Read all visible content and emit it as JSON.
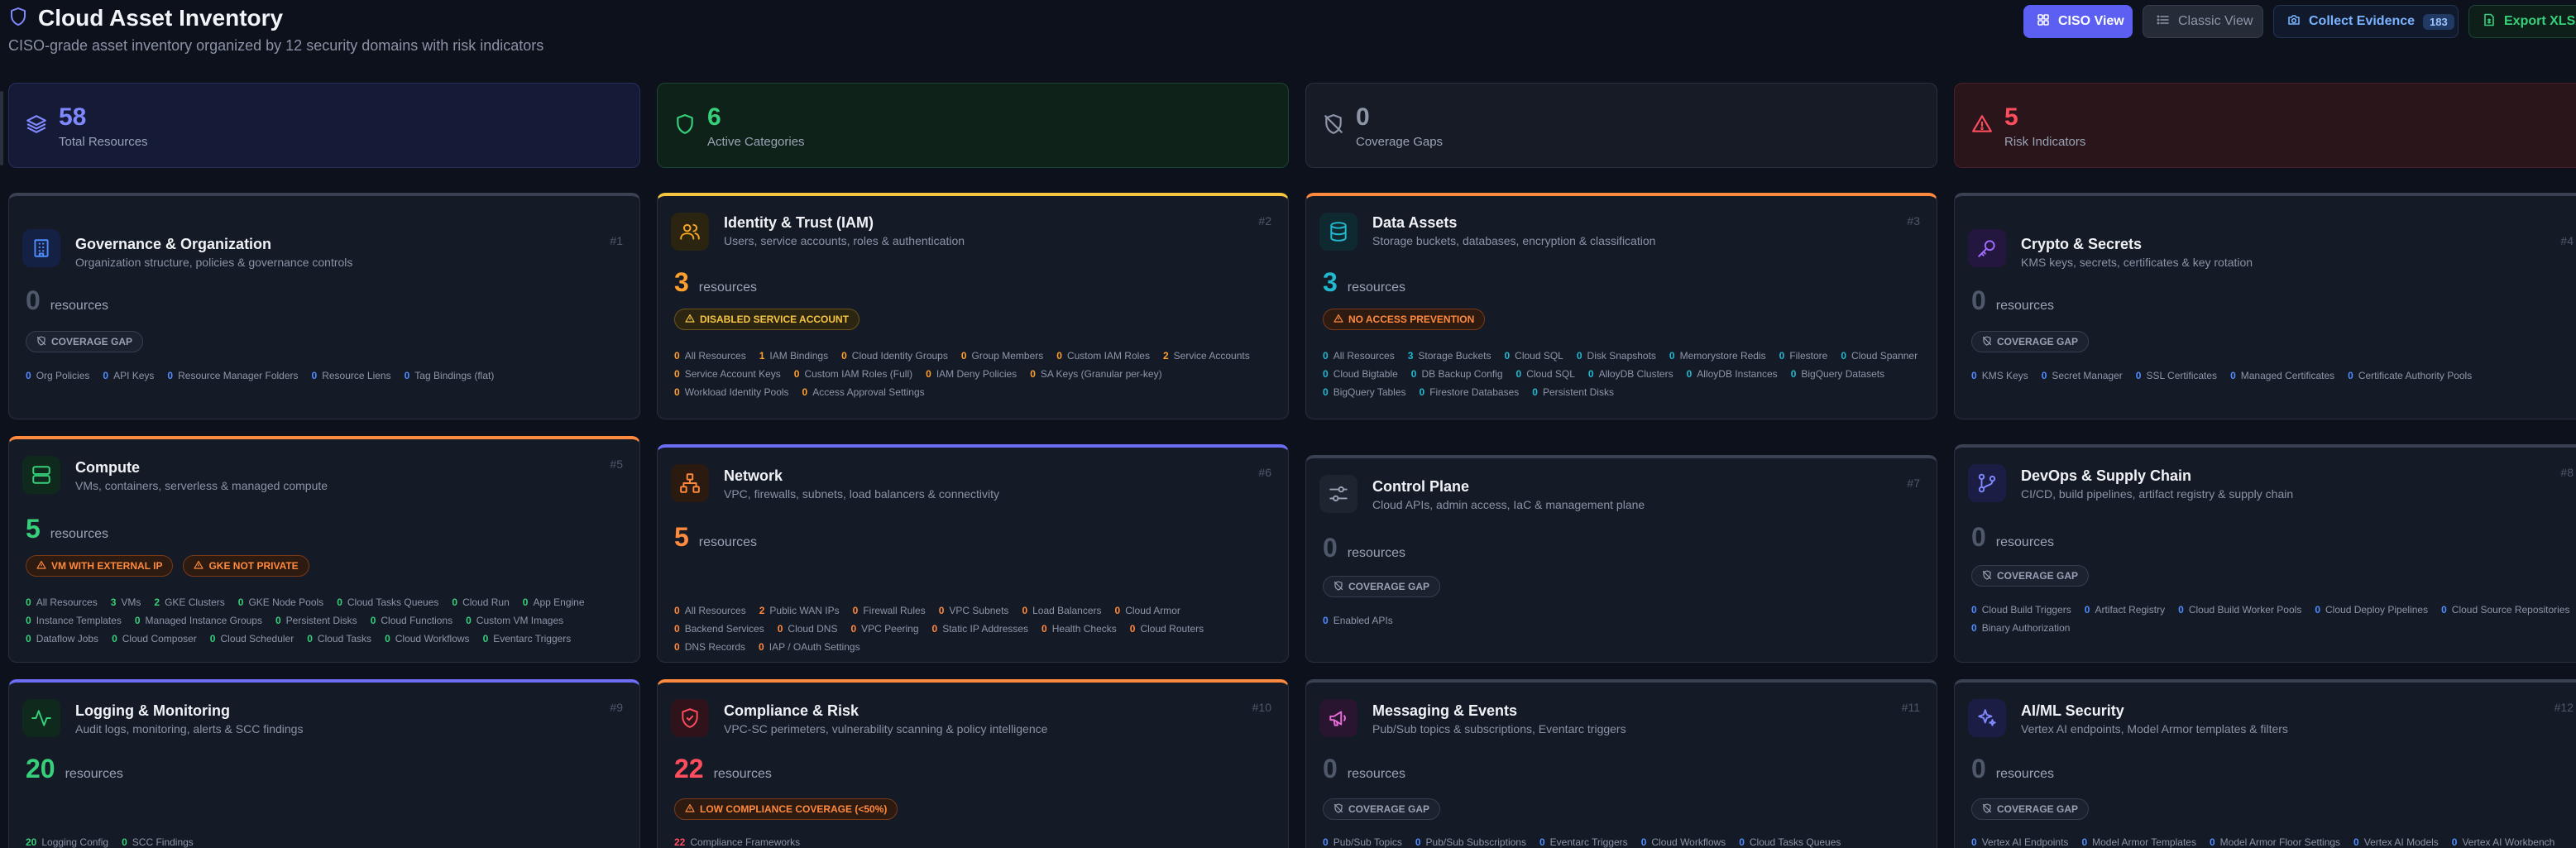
{
  "header": {
    "title": "Cloud Asset Inventory",
    "subtitle": "CISO-grade asset inventory organized by 12 security domains with risk indicators"
  },
  "actions": {
    "ciso_view": "CISO View",
    "classic_view": "Classic View",
    "collect_evidence": "Collect Evidence",
    "evidence_count": "183",
    "export_xlsx": "Export XLSX"
  },
  "stats": {
    "total": {
      "value": "58",
      "label": "Total Resources"
    },
    "active": {
      "value": "6",
      "label": "Active Categories"
    },
    "gaps": {
      "value": "0",
      "label": "Coverage Gaps"
    },
    "risk": {
      "value": "5",
      "label": "Risk Indicators"
    }
  },
  "resources_label": "resources",
  "colors": {
    "accent": "#5b5ff2",
    "green": "#36d07a",
    "orange": "#ff8a3d",
    "yellow": "#f5c542",
    "cyan": "#22b8cf",
    "red": "#ff4d5e",
    "gray": "#4f586a"
  },
  "cards": [
    {
      "title": "Governance & Organization",
      "desc": "Organization structure, policies & governance controls",
      "num": "#1",
      "count": "0",
      "icon": "building-icon",
      "badges": [
        {
          "label": "COVERAGE GAP",
          "type": "gap"
        }
      ],
      "items": [
        {
          "c": "0",
          "l": "Org Policies"
        },
        {
          "c": "0",
          "l": "API Keys"
        },
        {
          "c": "0",
          "l": "Resource Manager Folders"
        },
        {
          "c": "0",
          "l": "Resource Liens"
        },
        {
          "c": "0",
          "l": "Tag Bindings (flat)"
        }
      ]
    },
    {
      "title": "Identity & Trust (IAM)",
      "desc": "Users, service accounts, roles & authentication",
      "num": "#2",
      "count": "3",
      "icon": "users-icon",
      "badges": [
        {
          "label": "DISABLED SERVICE ACCOUNT",
          "type": "yellow"
        }
      ],
      "items": [
        {
          "c": "0",
          "l": "All Resources"
        },
        {
          "c": "1",
          "l": "IAM Bindings"
        },
        {
          "c": "0",
          "l": "Cloud Identity Groups"
        },
        {
          "c": "0",
          "l": "Group Members"
        },
        {
          "c": "0",
          "l": "Custom IAM Roles"
        },
        {
          "c": "2",
          "l": "Service Accounts"
        },
        {
          "c": "0",
          "l": "Service Account Keys"
        },
        {
          "c": "0",
          "l": "Custom IAM Roles (Full)"
        },
        {
          "c": "0",
          "l": "IAM Deny Policies"
        },
        {
          "c": "0",
          "l": "SA Keys (Granular per-key)"
        },
        {
          "c": "0",
          "l": "Workload Identity Pools"
        },
        {
          "c": "0",
          "l": "Access Approval Settings"
        }
      ]
    },
    {
      "title": "Data Assets",
      "desc": "Storage buckets, databases, encryption & classification",
      "num": "#3",
      "count": "3",
      "icon": "database-icon",
      "badges": [
        {
          "label": "NO ACCESS PREVENTION",
          "type": "orange"
        }
      ],
      "items": [
        {
          "c": "0",
          "l": "All Resources"
        },
        {
          "c": "3",
          "l": "Storage Buckets"
        },
        {
          "c": "0",
          "l": "Cloud SQL"
        },
        {
          "c": "0",
          "l": "Disk Snapshots"
        },
        {
          "c": "0",
          "l": "Memorystore Redis"
        },
        {
          "c": "0",
          "l": "Filestore"
        },
        {
          "c": "0",
          "l": "Cloud Spanner"
        },
        {
          "c": "0",
          "l": "Cloud Bigtable"
        },
        {
          "c": "0",
          "l": "DB Backup Config"
        },
        {
          "c": "0",
          "l": "Cloud SQL"
        },
        {
          "c": "0",
          "l": "AlloyDB Clusters"
        },
        {
          "c": "0",
          "l": "AlloyDB Instances"
        },
        {
          "c": "0",
          "l": "BigQuery Datasets"
        },
        {
          "c": "0",
          "l": "BigQuery Tables"
        },
        {
          "c": "0",
          "l": "Firestore Databases"
        },
        {
          "c": "0",
          "l": "Persistent Disks"
        }
      ]
    },
    {
      "title": "Crypto & Secrets",
      "desc": "KMS keys, secrets, certificates & key rotation",
      "num": "#4",
      "count": "0",
      "icon": "key-icon",
      "badges": [
        {
          "label": "COVERAGE GAP",
          "type": "gap"
        }
      ],
      "items": [
        {
          "c": "0",
          "l": "KMS Keys"
        },
        {
          "c": "0",
          "l": "Secret Manager"
        },
        {
          "c": "0",
          "l": "SSL Certificates"
        },
        {
          "c": "0",
          "l": "Managed Certificates"
        },
        {
          "c": "0",
          "l": "Certificate Authority Pools"
        }
      ]
    },
    {
      "title": "Compute",
      "desc": "VMs, containers, serverless & managed compute",
      "num": "#5",
      "count": "5",
      "icon": "server-icon",
      "badges": [
        {
          "label": "VM WITH EXTERNAL IP",
          "type": "orange"
        },
        {
          "label": "GKE NOT PRIVATE",
          "type": "orange"
        }
      ],
      "items": [
        {
          "c": "0",
          "l": "All Resources"
        },
        {
          "c": "3",
          "l": "VMs"
        },
        {
          "c": "2",
          "l": "GKE Clusters"
        },
        {
          "c": "0",
          "l": "GKE Node Pools"
        },
        {
          "c": "0",
          "l": "Cloud Tasks Queues"
        },
        {
          "c": "0",
          "l": "Cloud Run"
        },
        {
          "c": "0",
          "l": "App Engine"
        },
        {
          "c": "0",
          "l": "Instance Templates"
        },
        {
          "c": "0",
          "l": "Managed Instance Groups"
        },
        {
          "c": "0",
          "l": "Persistent Disks"
        },
        {
          "c": "0",
          "l": "Cloud Functions"
        },
        {
          "c": "0",
          "l": "Custom VM Images"
        },
        {
          "c": "0",
          "l": "Dataflow Jobs"
        },
        {
          "c": "0",
          "l": "Cloud Composer"
        },
        {
          "c": "0",
          "l": "Cloud Scheduler"
        },
        {
          "c": "0",
          "l": "Cloud Tasks"
        },
        {
          "c": "0",
          "l": "Cloud Workflows"
        },
        {
          "c": "0",
          "l": "Eventarc Triggers"
        }
      ]
    },
    {
      "title": "Network",
      "desc": "VPC, firewalls, subnets, load balancers & connectivity",
      "num": "#6",
      "count": "5",
      "icon": "network-icon",
      "badges": [],
      "items": [
        {
          "c": "0",
          "l": "All Resources"
        },
        {
          "c": "2",
          "l": "Public WAN IPs"
        },
        {
          "c": "0",
          "l": "Firewall Rules"
        },
        {
          "c": "0",
          "l": "VPC Subnets"
        },
        {
          "c": "0",
          "l": "Load Balancers"
        },
        {
          "c": "0",
          "l": "Cloud Armor"
        },
        {
          "c": "0",
          "l": "Backend Services"
        },
        {
          "c": "0",
          "l": "Cloud DNS"
        },
        {
          "c": "0",
          "l": "VPC Peering"
        },
        {
          "c": "0",
          "l": "Static IP Addresses"
        },
        {
          "c": "0",
          "l": "Health Checks"
        },
        {
          "c": "0",
          "l": "Cloud Routers"
        },
        {
          "c": "0",
          "l": "DNS Records"
        },
        {
          "c": "0",
          "l": "IAP / OAuth Settings"
        }
      ]
    },
    {
      "title": "Control Plane",
      "desc": "Cloud APIs, admin access, IaC & management plane",
      "num": "#7",
      "count": "0",
      "icon": "sliders-icon",
      "badges": [
        {
          "label": "COVERAGE GAP",
          "type": "gap"
        }
      ],
      "items": [
        {
          "c": "0",
          "l": "Enabled APIs"
        }
      ]
    },
    {
      "title": "DevOps & Supply Chain",
      "desc": "CI/CD, build pipelines, artifact registry & supply chain",
      "num": "#8",
      "count": "0",
      "icon": "git-branch-icon",
      "badges": [
        {
          "label": "COVERAGE GAP",
          "type": "gap"
        }
      ],
      "items": [
        {
          "c": "0",
          "l": "Cloud Build Triggers"
        },
        {
          "c": "0",
          "l": "Artifact Registry"
        },
        {
          "c": "0",
          "l": "Cloud Build Worker Pools"
        },
        {
          "c": "0",
          "l": "Cloud Deploy Pipelines"
        },
        {
          "c": "0",
          "l": "Cloud Source Repositories"
        },
        {
          "c": "0",
          "l": "Binary Authorization"
        }
      ]
    },
    {
      "title": "Logging & Monitoring",
      "desc": "Audit logs, monitoring, alerts & SCC findings",
      "num": "#9",
      "count": "20",
      "icon": "activity-icon",
      "badges": [],
      "items": [
        {
          "c": "20",
          "l": "Logging Config"
        },
        {
          "c": "0",
          "l": "SCC Findings"
        }
      ]
    },
    {
      "title": "Compliance & Risk",
      "desc": "VPC-SC perimeters, vulnerability scanning & policy intelligence",
      "num": "#10",
      "count": "22",
      "icon": "shield-alert-icon",
      "badges": [
        {
          "label": "LOW COMPLIANCE COVERAGE (<50%)",
          "type": "orange"
        }
      ],
      "items": [
        {
          "c": "22",
          "l": "Compliance Frameworks"
        }
      ]
    },
    {
      "title": "Messaging & Events",
      "desc": "Pub/Sub topics & subscriptions, Eventarc triggers",
      "num": "#11",
      "count": "0",
      "icon": "megaphone-icon",
      "badges": [
        {
          "label": "COVERAGE GAP",
          "type": "gap"
        }
      ],
      "items": [
        {
          "c": "0",
          "l": "Pub/Sub Topics"
        },
        {
          "c": "0",
          "l": "Pub/Sub Subscriptions"
        },
        {
          "c": "0",
          "l": "Eventarc Triggers"
        },
        {
          "c": "0",
          "l": "Cloud Workflows"
        },
        {
          "c": "0",
          "l": "Cloud Tasks Queues"
        }
      ]
    },
    {
      "title": "AI/ML Security",
      "desc": "Vertex AI endpoints, Model Armor templates & filters",
      "num": "#12",
      "count": "0",
      "icon": "sparkles-icon",
      "badges": [
        {
          "label": "COVERAGE GAP",
          "type": "gap"
        }
      ],
      "items": [
        {
          "c": "0",
          "l": "Vertex AI Endpoints"
        },
        {
          "c": "0",
          "l": "Model Armor Templates"
        },
        {
          "c": "0",
          "l": "Model Armor Floor Settings"
        },
        {
          "c": "0",
          "l": "Vertex AI Models"
        },
        {
          "c": "0",
          "l": "Vertex AI Workbench"
        }
      ]
    }
  ]
}
